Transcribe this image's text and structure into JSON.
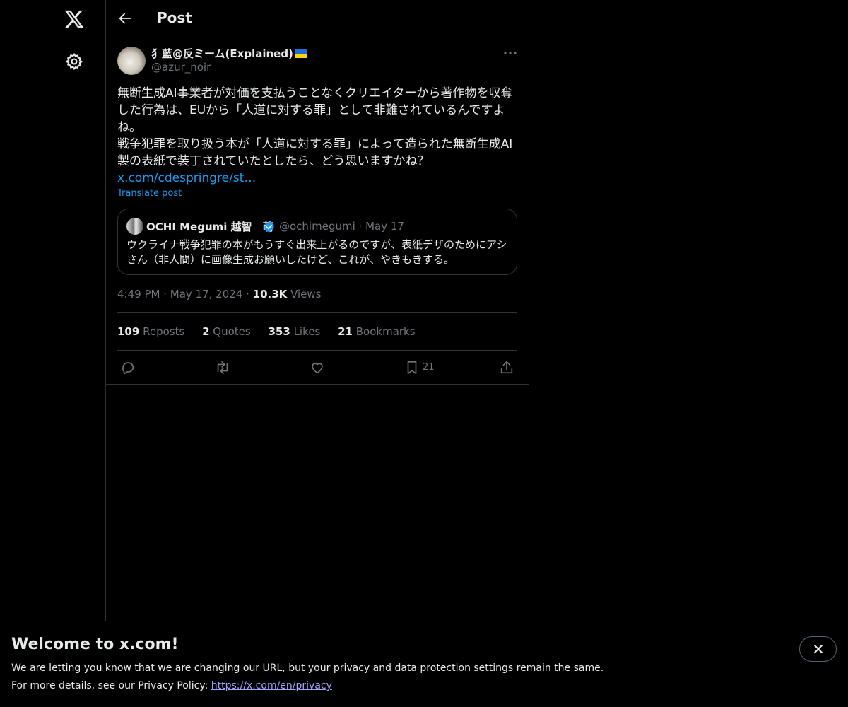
{
  "header": {
    "title": "Post"
  },
  "post": {
    "author_name": "犭藍@反ミーム(Explained)",
    "author_handle": "@azur_noir",
    "text_line1": "無断生成AI事業者が対価を支払うことなくクリエイターから著作物を収奪した行為は、EUから「人道に対する罪」として非難されているんですよね。",
    "text_line2": "戦争犯罪を取り扱う本が「人道に対する罪」によって造られた無断生成AI製の表紙で装丁されていたとしたら、どう思いますかね？",
    "link_text": "x.com/cdespringre/st…",
    "translate_label": "Translate post",
    "time": "4:49 PM",
    "date": "May 17, 2024",
    "views_count": "10.3K",
    "views_label": "Views"
  },
  "quote": {
    "name": "OCHI Megumi 越智　萌",
    "handle": "@ochimegumi",
    "date": "May 17",
    "text": "ウクライナ戦争犯罪の本がもうすぐ出来上がるのですが、表紙デザのためにアシさん（非人間）に画像生成お願いしたけど、これが、やきもきする。"
  },
  "stats": {
    "reposts_count": "109",
    "reposts_label": "Reposts",
    "quotes_count": "2",
    "quotes_label": "Quotes",
    "likes_count": "353",
    "likes_label": "Likes",
    "bookmarks_count": "21",
    "bookmarks_label": "Bookmarks"
  },
  "actions": {
    "bookmark_count": "21"
  },
  "banner": {
    "title": "Welcome to x.com!",
    "line1": "We are letting you know that we are changing our URL, but your privacy and data protection settings remain the same.",
    "line2_prefix": "For more details, see our Privacy Policy: ",
    "link": "https://x.com/en/privacy"
  },
  "icons": {
    "logo": "x-logo-icon",
    "settings": "gear-icon",
    "back": "arrow-left-icon",
    "more": "more-horizontal-icon",
    "verified": "verified-badge-icon",
    "reply": "reply-icon",
    "repost": "repost-icon",
    "like": "heart-icon",
    "bookmark": "bookmark-icon",
    "share": "share-icon",
    "close": "close-icon"
  },
  "colors": {
    "accent": "#1d9bf0",
    "muted": "#71767b",
    "border": "#2f3336",
    "background": "#000000"
  }
}
